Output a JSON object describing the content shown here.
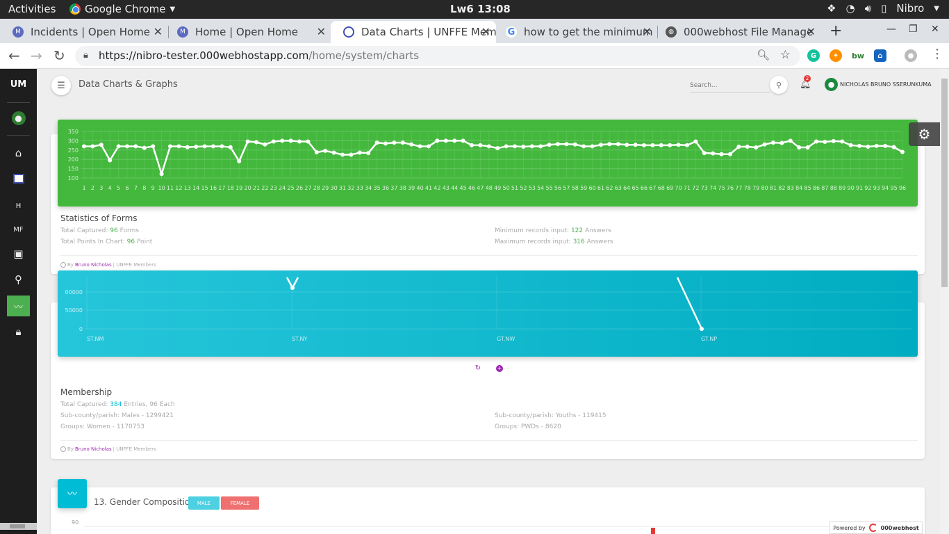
{
  "system": {
    "activities": "Activities",
    "app_name": "Google Chrome",
    "clock": "Lw6 13:08",
    "user": "Nibro"
  },
  "tabs": [
    {
      "title": "Incidents | Open Home",
      "active": false
    },
    {
      "title": "Home | Open Home",
      "active": false
    },
    {
      "title": "Data Charts | UNFFE Mem",
      "active": true
    },
    {
      "title": "how to get the minimum",
      "active": false
    },
    {
      "title": "000webhost File Manage",
      "active": false
    }
  ],
  "address": {
    "host": "https://nibro-tester.000webhostapp.com",
    "path": "/home/system/charts"
  },
  "sidebar": {
    "brand": "UM",
    "items": [
      {
        "name": "user-icon"
      },
      {
        "name": "home-icon"
      },
      {
        "name": "logo-icon"
      },
      {
        "name": "h-item",
        "label": "H"
      },
      {
        "name": "mf-item",
        "label": "MF"
      },
      {
        "name": "image-icon"
      },
      {
        "name": "location-icon"
      },
      {
        "name": "chart-icon",
        "active": true
      },
      {
        "name": "lock-icon"
      }
    ]
  },
  "header": {
    "title": "Data Charts & Graphs",
    "search_placeholder": "Search...",
    "notifications": "2",
    "user_name": "NICHOLAS BRUNO SSERUNKUMA"
  },
  "forms_card": {
    "title": "Statistics of Forms",
    "total_captured_label": "Total Captured:",
    "total_captured_value": "96",
    "total_captured_unit": "Forms",
    "total_points_label": "Total Points In Chart:",
    "total_points_value": "96",
    "total_points_unit": "Point",
    "min_label": "Minimum records input:",
    "min_value": "122",
    "min_unit": "Answers",
    "max_label": "Maximum records input:",
    "max_value": "316",
    "max_unit": "Answers",
    "footer_by": "By",
    "footer_name": "Bruno Nicholas",
    "footer_rest": "| UNFFE Members"
  },
  "membership_card": {
    "title": "Membership",
    "total_label": "Total Captured:",
    "total_value": "384",
    "total_rest": "Entries, 96 Each",
    "males": "Sub-county/parish: Males - 1299421",
    "youths": "Sub-county/parish: Youths - 119415",
    "women": "Groups: Women - 1170753",
    "pwds": "Groups: PWDs - 8620",
    "footer_by": "By",
    "footer_name": "Bruno Nicholas",
    "footer_rest": "| UNFFE Members"
  },
  "gender_card": {
    "title": "13. Gender Composition -",
    "male_label": "MALE",
    "female_label": "FEMALE",
    "y_top": "90"
  },
  "powered": {
    "text": "Powered by",
    "brand": "000webhost"
  },
  "colors": {
    "green": "#43a047",
    "cyan": "#00bcd4",
    "male": "#4dd0e1",
    "female": "#ef5350"
  },
  "chart_data": [
    {
      "type": "line",
      "title": "",
      "x": [
        1,
        2,
        3,
        4,
        5,
        6,
        7,
        8,
        9,
        10,
        11,
        12,
        13,
        14,
        15,
        16,
        17,
        18,
        19,
        20,
        21,
        22,
        23,
        24,
        25,
        26,
        27,
        28,
        29,
        30,
        31,
        32,
        33,
        34,
        35,
        36,
        37,
        38,
        39,
        40,
        41,
        42,
        43,
        44,
        45,
        46,
        47,
        48,
        49,
        50,
        51,
        52,
        53,
        54,
        55,
        56,
        57,
        58,
        59,
        60,
        61,
        62,
        63,
        64,
        65,
        66,
        67,
        68,
        69,
        70,
        71,
        72,
        73,
        74,
        75,
        76,
        77,
        78,
        79,
        80,
        81,
        82,
        83,
        84,
        85,
        86,
        87,
        88,
        89,
        90,
        91,
        92,
        93,
        94,
        95,
        96
      ],
      "values": [
        270,
        270,
        278,
        195,
        270,
        270,
        270,
        262,
        270,
        122,
        270,
        270,
        265,
        268,
        270,
        270,
        270,
        265,
        190,
        296,
        292,
        280,
        296,
        300,
        300,
        296,
        296,
        238,
        246,
        236,
        225,
        225,
        236,
        234,
        290,
        285,
        290,
        290,
        280,
        270,
        270,
        300,
        300,
        300,
        300,
        276,
        276,
        270,
        260,
        270,
        270,
        268,
        270,
        270,
        278,
        282,
        282,
        280,
        270,
        270,
        278,
        282,
        282,
        278,
        278,
        276,
        276,
        276,
        276,
        278,
        276,
        296,
        234,
        232,
        228,
        228,
        268,
        268,
        264,
        280,
        290,
        288,
        300,
        264,
        264,
        296,
        294,
        298,
        296,
        276,
        272,
        268,
        272,
        272,
        266,
        240
      ],
      "ylim": [
        100,
        350
      ],
      "yticks": [
        100,
        150,
        200,
        250,
        300,
        350
      ],
      "grid": true
    },
    {
      "type": "line",
      "title": "",
      "categories": [
        "ST.NM",
        "ST.NY",
        "GT.NW",
        "GT.NP"
      ],
      "yticks": [
        "0",
        "50000",
        "00000"
      ],
      "grid": true
    }
  ]
}
